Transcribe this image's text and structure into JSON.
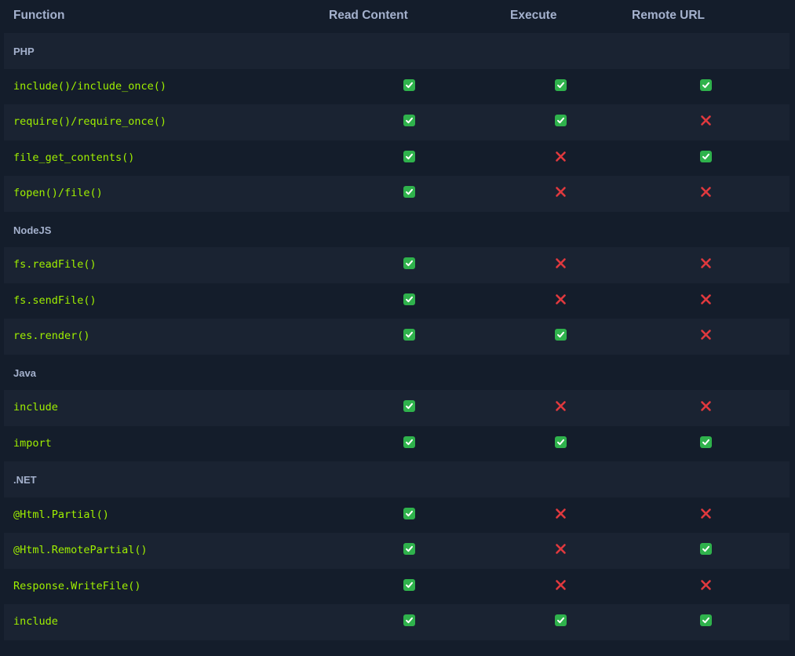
{
  "headers": {
    "function": "Function",
    "read": "Read Content",
    "execute": "Execute",
    "remote": "Remote URL"
  },
  "sections": [
    {
      "name": "PHP",
      "rows": [
        {
          "fn": "include()/include_once()",
          "read": true,
          "execute": true,
          "remote": true
        },
        {
          "fn": "require()/require_once()",
          "read": true,
          "execute": true,
          "remote": false
        },
        {
          "fn": "file_get_contents()",
          "read": true,
          "execute": false,
          "remote": true
        },
        {
          "fn": "fopen()/file()",
          "read": true,
          "execute": false,
          "remote": false
        }
      ]
    },
    {
      "name": "NodeJS",
      "rows": [
        {
          "fn": "fs.readFile()",
          "read": true,
          "execute": false,
          "remote": false
        },
        {
          "fn": "fs.sendFile()",
          "read": true,
          "execute": false,
          "remote": false
        },
        {
          "fn": "res.render()",
          "read": true,
          "execute": true,
          "remote": false
        }
      ]
    },
    {
      "name": "Java",
      "rows": [
        {
          "fn": "include",
          "read": true,
          "execute": false,
          "remote": false
        },
        {
          "fn": "import",
          "read": true,
          "execute": true,
          "remote": true
        }
      ]
    },
    {
      "name": ".NET",
      "rows": [
        {
          "fn": "@Html.Partial()",
          "read": true,
          "execute": false,
          "remote": false
        },
        {
          "fn": "@Html.RemotePartial()",
          "read": true,
          "execute": false,
          "remote": true
        },
        {
          "fn": "Response.WriteFile()",
          "read": true,
          "execute": false,
          "remote": false
        },
        {
          "fn": "include",
          "read": true,
          "execute": true,
          "remote": true
        }
      ]
    }
  ],
  "colors": {
    "background": "#141d2b",
    "row_alt": "#1a2332",
    "header_text": "#a4b1cd",
    "function_text": "#9fef00",
    "check_bg": "#2fb24c",
    "cross": "#e0393e"
  },
  "icons": {
    "yes": "check-icon",
    "no": "cross-icon"
  }
}
